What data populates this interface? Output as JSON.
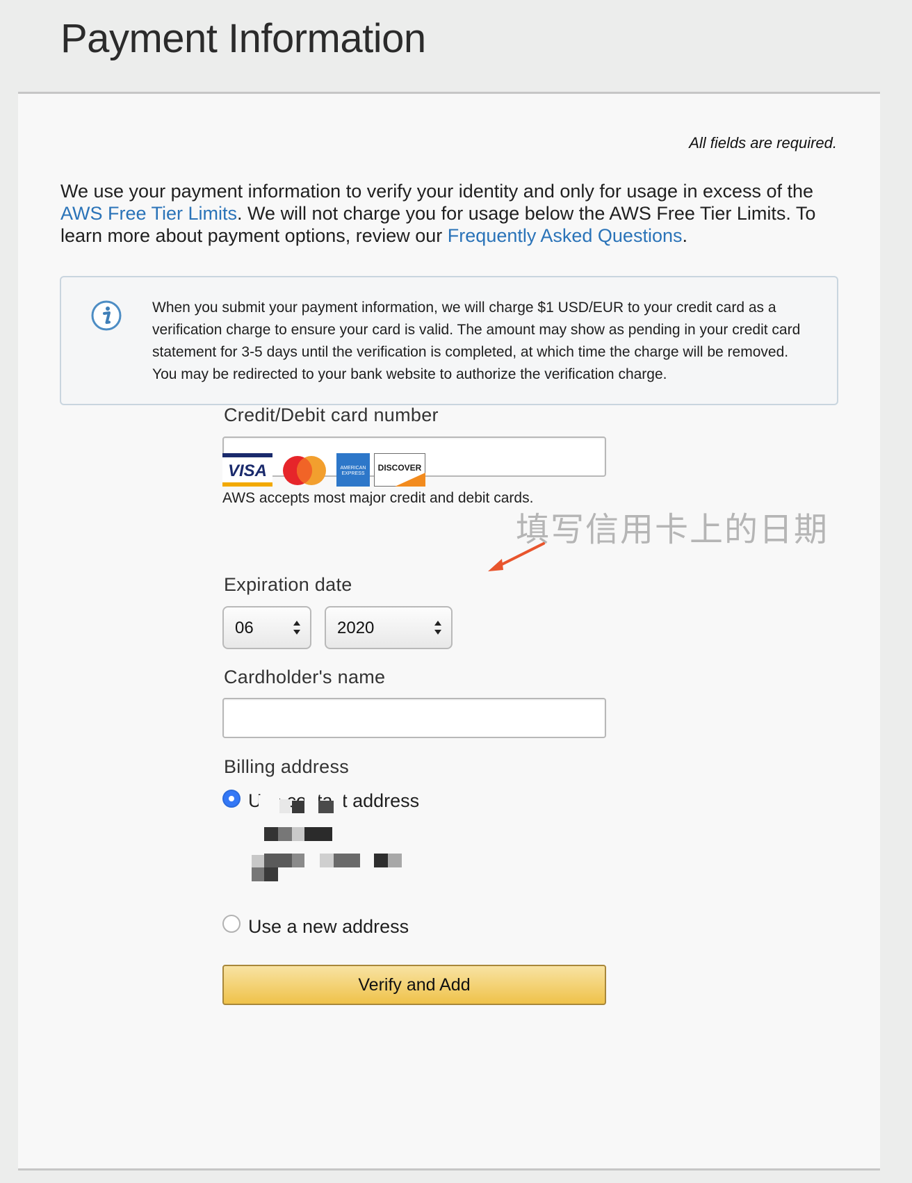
{
  "page": {
    "title": "Payment Information",
    "required_note": "All fields are required."
  },
  "intro": {
    "part1": "We use your payment information to verify your identity and only for usage in excess of the ",
    "link1": "AWS Free Tier Limits",
    "part2": ". We will not charge you for usage below the AWS Free Tier Limits. To learn more about payment options, review our ",
    "link2": "Frequently Asked Questions",
    "part3": "."
  },
  "info_box": {
    "icon": "info-icon",
    "text": "When you submit your payment information, we will charge $1 USD/EUR to your credit card as a verification charge to ensure your card is valid. The amount may show as pending in your credit card statement for 3-5 days until the verification is completed, at which time the charge will be removed. You may be redirected to your bank website to authorize the verification charge."
  },
  "card_number": {
    "label": "Credit/Debit card number",
    "value": ""
  },
  "card_logos": {
    "visa": "VISA",
    "amex_line1": "AMERICAN",
    "amex_line2": "EXPRESS",
    "discover": "DISCOVER"
  },
  "cards_note": "AWS accepts most major credit and debit cards.",
  "expiration": {
    "label": "Expiration date",
    "month": "06",
    "year": "2020"
  },
  "annotation": {
    "text": "填写信用卡上的日期",
    "color": "#e8552d"
  },
  "cardholder": {
    "label": "Cardholder's name",
    "value": ""
  },
  "billing": {
    "label": "Billing address",
    "option_contact": "Use contact address",
    "option_new": "Use a new address"
  },
  "verify_button": "Verify and Add",
  "colors": {
    "link": "#2a73b8",
    "button_gradient_top": "#f8e3a3",
    "button_gradient_bottom": "#efc24a",
    "radio_checked": "#3478f6"
  }
}
